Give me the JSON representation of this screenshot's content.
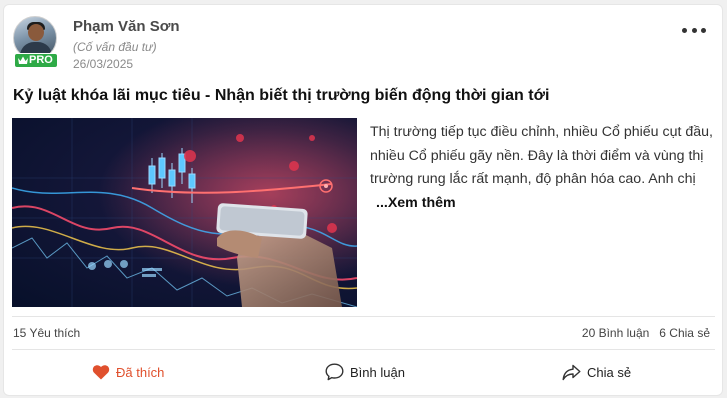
{
  "author": {
    "name": "Phạm Văn Sơn",
    "role": "(Cố vấn đầu tư)",
    "date": "26/03/2025",
    "badge": "PRO",
    "avatar_icon": "user-avatar"
  },
  "post": {
    "title": "Kỷ luật khóa lãi mục tiêu - Nhận biết thị trường biến động thời gian tới",
    "excerpt": "Thị trường tiếp tục điều chỉnh, nhiều Cổ phiếu cụt đầu, nhiều Cổ phiếu gãy nền. Đây là thời điểm và vùng thị trường rung lắc rất mạnh, độ phân hóa cao. Anh chị",
    "see_more": "...Xem thêm",
    "image_description_icon": "stock-market-image"
  },
  "stats": {
    "likes": "15 Yêu thích",
    "comments": "20 Bình luận",
    "shares": "6 Chia sẻ"
  },
  "actions": {
    "like": "Đã thích",
    "comment": "Bình luận",
    "share": "Chia sẻ"
  },
  "colors": {
    "badge_green": "#2eaa46",
    "liked_orange": "#e0502d",
    "text_dark": "#222222"
  }
}
